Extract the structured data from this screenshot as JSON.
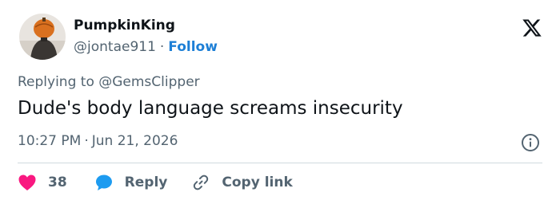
{
  "user": {
    "display_name": "PumpkinKing",
    "handle": "@jontae911",
    "separator": "·",
    "follow_label": "Follow"
  },
  "tweet": {
    "replying_to": "Replying to @GemsClipper",
    "text": "Dude's body language screams insecurity",
    "time": "10:27 PM",
    "separator": "·",
    "date": "Jun 21, 2026"
  },
  "actions": {
    "like_count": "38",
    "reply_label": "Reply",
    "copy_link_label": "Copy link"
  },
  "colors": {
    "like": "#f91880",
    "reply": "#1d9bf0",
    "follow": "#1d7fd6",
    "muted": "#536471",
    "divider": "#cfd9de"
  },
  "icons": [
    "avatar",
    "x-logo-icon",
    "info-icon",
    "heart-icon",
    "reply-bubble-icon",
    "link-icon"
  ]
}
